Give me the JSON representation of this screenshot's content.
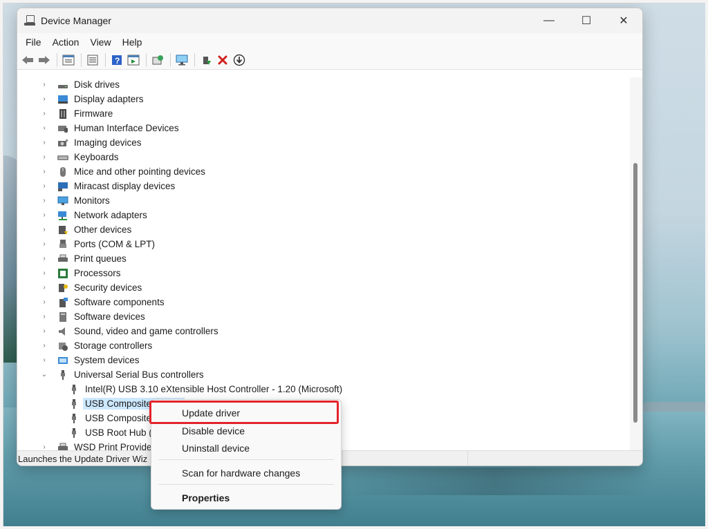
{
  "window": {
    "title": "Device Manager",
    "controls": {
      "minimize": "—",
      "maximize": "☐",
      "close": "✕"
    }
  },
  "menu": [
    "File",
    "Action",
    "View",
    "Help"
  ],
  "toolbar": {
    "buttons": [
      "back-icon",
      "forward-icon",
      "properties-icon",
      "view-icon",
      "help-icon",
      "action-icon",
      "scan-icon",
      "monitor-icon",
      "update-driver-icon",
      "uninstall-icon",
      "enable-icon"
    ],
    "colors": {
      "uninstall": "#d0211c",
      "back": "#6e6e6e"
    }
  },
  "tree": {
    "categories": [
      {
        "label": "Disk drives",
        "icon": "disk-drive-icon"
      },
      {
        "label": "Display adapters",
        "icon": "display-adapter-icon"
      },
      {
        "label": "Firmware",
        "icon": "firmware-icon"
      },
      {
        "label": "Human Interface Devices",
        "icon": "hid-icon"
      },
      {
        "label": "Imaging devices",
        "icon": "camera-icon"
      },
      {
        "label": "Keyboards",
        "icon": "keyboard-icon"
      },
      {
        "label": "Mice and other pointing devices",
        "icon": "mouse-icon"
      },
      {
        "label": "Miracast display devices",
        "icon": "miracast-icon"
      },
      {
        "label": "Monitors",
        "icon": "monitor-icon"
      },
      {
        "label": "Network adapters",
        "icon": "network-icon"
      },
      {
        "label": "Other devices",
        "icon": "other-device-icon"
      },
      {
        "label": "Ports (COM & LPT)",
        "icon": "port-icon"
      },
      {
        "label": "Print queues",
        "icon": "printer-icon"
      },
      {
        "label": "Processors",
        "icon": "processor-icon"
      },
      {
        "label": "Security devices",
        "icon": "security-icon"
      },
      {
        "label": "Software components",
        "icon": "software-component-icon"
      },
      {
        "label": "Software devices",
        "icon": "software-device-icon"
      },
      {
        "label": "Sound, video and game controllers",
        "icon": "speaker-icon"
      },
      {
        "label": "Storage controllers",
        "icon": "storage-icon"
      },
      {
        "label": "System devices",
        "icon": "system-icon"
      }
    ],
    "usb": {
      "label": "Universal Serial Bus controllers",
      "children": [
        "Intel(R) USB 3.10 eXtensible Host Controller - 1.20 (Microsoft)",
        "USB Composite Device",
        "USB Composite",
        "USB Root Hub (U"
      ],
      "selected_index": 1
    },
    "last_partial": "WSD Print Provider"
  },
  "status": {
    "text": "Launches the Update Driver Wiz"
  },
  "context_menu": {
    "update": "Update driver",
    "disable": "Disable device",
    "uninstall": "Uninstall device",
    "scan": "Scan for hardware changes",
    "properties": "Properties",
    "highlight_color": "#e3232b"
  }
}
